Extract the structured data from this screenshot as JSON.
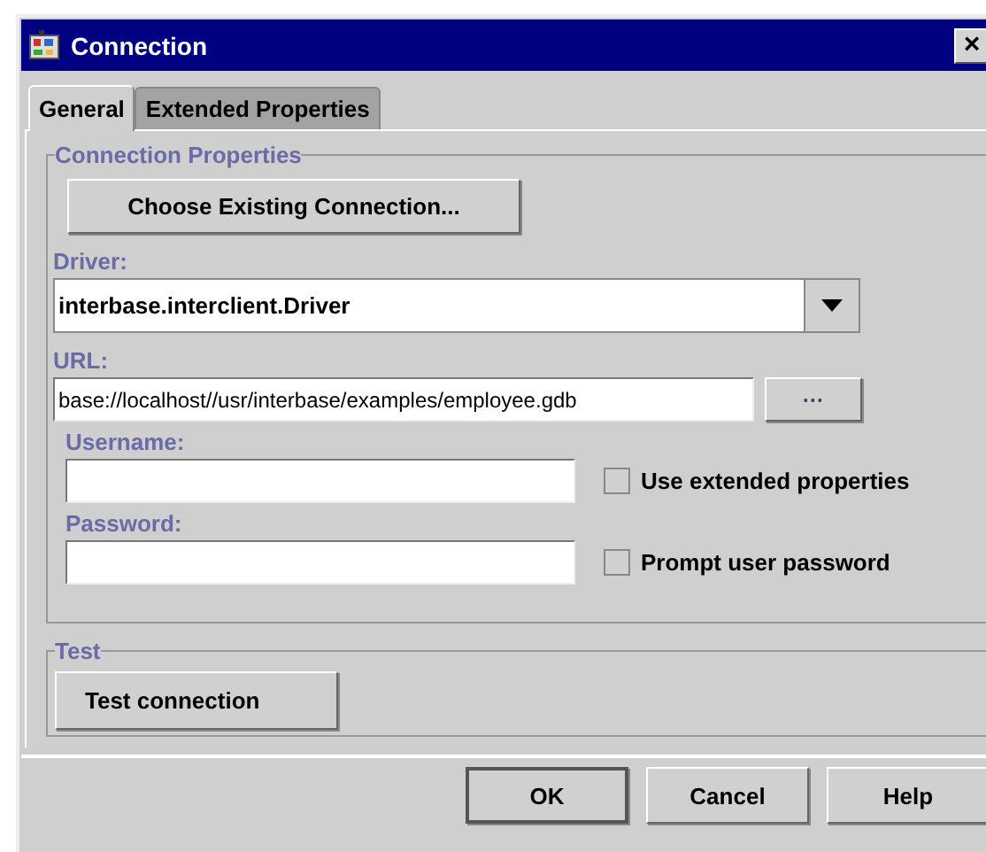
{
  "window": {
    "title": "Connection",
    "close": "×"
  },
  "tabs": [
    {
      "label": "General",
      "selected": true
    },
    {
      "label": "Extended Properties",
      "selected": false
    }
  ],
  "connection_properties": {
    "title": "Connection Properties",
    "choose_button": "Choose Existing Connection...",
    "driver_label": "Driver:",
    "driver_value": "interbase.interclient.Driver",
    "url_label": "URL:",
    "url_value": "base://localhost//usr/interbase/examples/employee.gdb",
    "browse_button": "···",
    "username_label": "Username:",
    "password_label": "Password:",
    "options": [
      {
        "label": "Use extended properties",
        "checked": false
      },
      {
        "label": "Prompt user password",
        "checked": false
      }
    ]
  },
  "test": {
    "title": "Test",
    "button": "Test connection"
  },
  "buttons": [
    {
      "label": "OK",
      "default": true
    },
    {
      "label": "Cancel",
      "default": false
    },
    {
      "label": "Help",
      "default": false
    }
  ]
}
